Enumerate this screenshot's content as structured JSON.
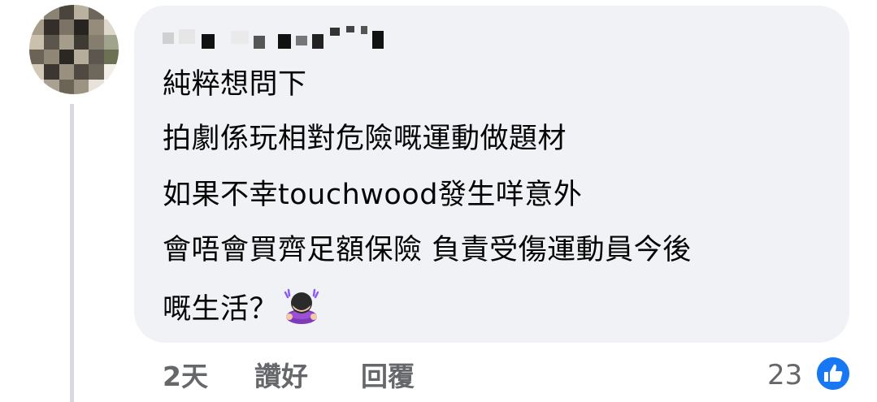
{
  "comment": {
    "lines": [
      "純粹想問下",
      "拍劇係玩相對危險嘅運動做題材",
      "如果不幸touchwood發生咩意外",
      "會唔會買齊足額保險 負責受傷運動員今後",
      "嘅生活？"
    ],
    "emoji": "woman-bowing-icon"
  },
  "actions": {
    "time": "2天",
    "like_label": "讚好",
    "reply_label": "回覆"
  },
  "reactions": {
    "count": "23",
    "icon": "thumbs-up-icon"
  },
  "colors": {
    "bubble": "#f0f2f5",
    "text": "#050505",
    "secondary_text": "#65676b",
    "like_blue": "#1877f2",
    "thread_line": "#d8dadf"
  }
}
